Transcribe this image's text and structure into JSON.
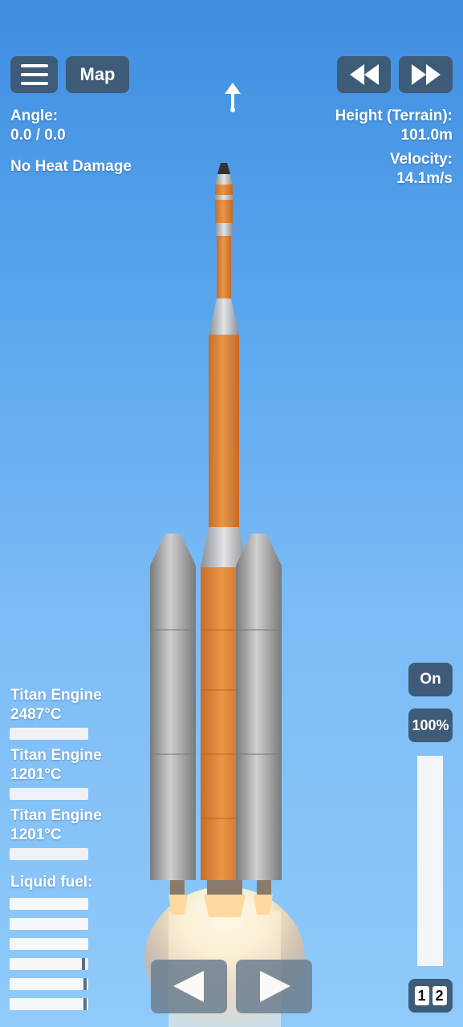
{
  "toolbar": {
    "menu_icon": "hamburger-icon",
    "map_label": "Map",
    "rewind_icon": "rewind-icon",
    "fastforward_icon": "fast-forward-icon",
    "direction_icon": "up-arrow-icon"
  },
  "left_info": {
    "angle_label": "Angle:",
    "angle_value": "0.0 / 0.0",
    "heat_status": "No Heat Damage"
  },
  "right_info": {
    "height_label": "Height (Terrain):",
    "height_value": "101.0m",
    "velocity_label": "Velocity:",
    "velocity_value": "14.1m/s"
  },
  "engines": [
    {
      "name": "Titan Engine",
      "temp": "2487°C"
    },
    {
      "name": "Titan Engine",
      "temp": "1201°C"
    },
    {
      "name": "Titan Engine",
      "temp": "1201°C"
    }
  ],
  "fuel": {
    "label": "Liquid fuel:",
    "levels": [
      1.0,
      1.0,
      1.0,
      0.96,
      0.98,
      0.98
    ]
  },
  "throttle": {
    "toggle_label": "On",
    "percent_label": "100%",
    "level": 1.0
  },
  "stage": {
    "a": "1",
    "b": "2"
  },
  "controls": {
    "left_icon": "left-arrow-icon",
    "right_icon": "right-arrow-icon"
  },
  "colors": {
    "sky_top": "#3f8de0",
    "sky_bottom": "#8fcafa",
    "button": "#3e5b78",
    "rocket_body": "#e08a3c",
    "booster": "#a9a9a9"
  }
}
